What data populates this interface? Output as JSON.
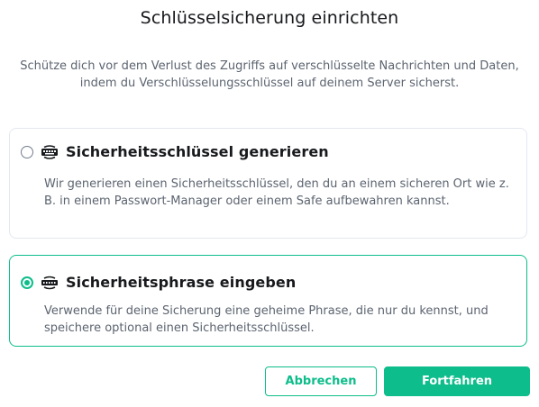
{
  "dialog": {
    "title": "Schlüsselsicherung einrichten",
    "description": "Schütze dich vor dem Verlust des Zugriffs auf verschlüsselte Nachrichten und Daten, indem du Verschlüsselungsschlüssel auf deinem Server sicherst."
  },
  "options": [
    {
      "label": "Sicherheitsschlüssel generieren",
      "description": "Wir generieren einen Sicherheitsschlüssel, den du an einem sicheren Ort wie z. B. in einem Passwort-Manager oder einem Safe aufbewahren kannst.",
      "selected": false,
      "icon": "key-icon"
    },
    {
      "label": "Sicherheitsphrase eingeben",
      "description": "Verwende für deine Sicherung eine geheime Phrase, die nur du kennst, und speichere optional einen Sicherheitsschlüssel.",
      "selected": true,
      "icon": "passphrase-icon"
    }
  ],
  "buttons": {
    "cancel": "Abbrechen",
    "continue": "Fortfahren"
  },
  "colors": {
    "accent": "#0dbd8b",
    "text": "#17191c",
    "secondary_text": "#5c6470",
    "border": "#e3e8f0"
  }
}
